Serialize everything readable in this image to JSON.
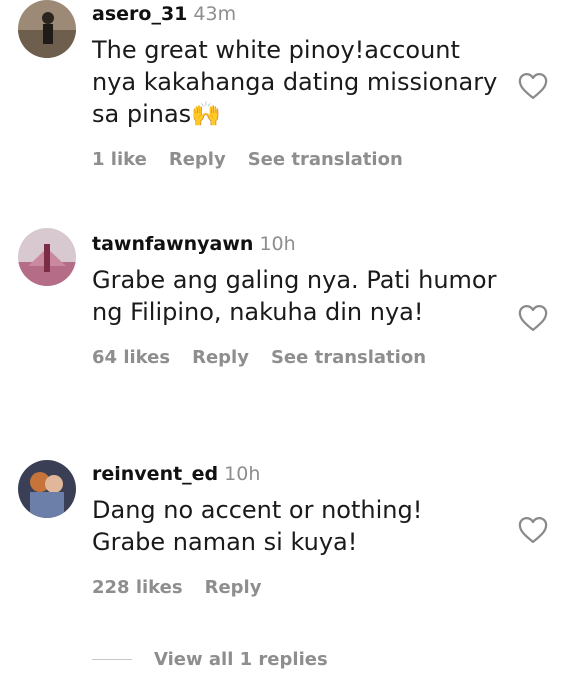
{
  "comments": [
    {
      "username": "asero_31",
      "time": "43m",
      "text": "The great white pinoy!account nya kakahanga dating missionary sa pinas",
      "emoji": "🙌",
      "likes": "1 like",
      "reply_label": "Reply",
      "translate_label": "See translation"
    },
    {
      "username": "tawnfawnyawn",
      "time": "10h",
      "text": "Grabe ang galing nya. Pati humor ng Filipino, nakuha din nya!",
      "likes": "64 likes",
      "reply_label": "Reply",
      "translate_label": "See translation"
    },
    {
      "username": "reinvent_ed",
      "time": "10h",
      "text": "Dang no accent or nothing! Grabe naman si kuya!",
      "likes": "228 likes",
      "reply_label": "Reply"
    }
  ],
  "view_replies_label": "View all 1 replies",
  "colors": {
    "meta_gray": "#8e8e8e",
    "text": "#111111"
  },
  "icons": {
    "like": "heart-outline-icon"
  }
}
